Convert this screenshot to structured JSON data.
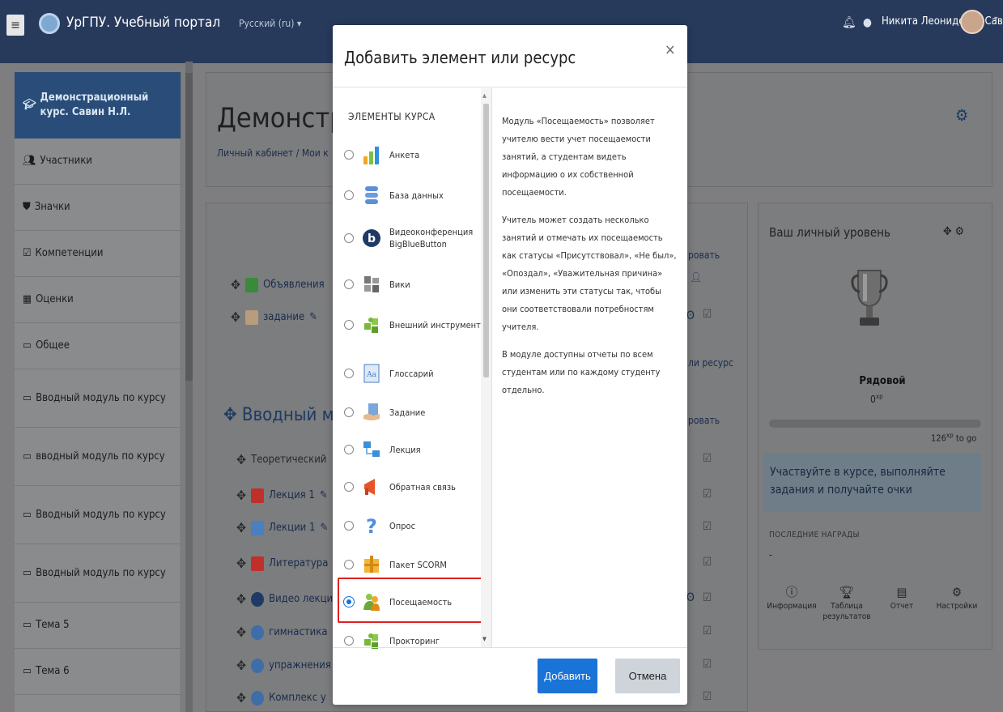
{
  "topbar": {
    "menu_icon": "hamburger-icon",
    "site_name": "УрГПУ. Учебный портал",
    "language": "Русский (ru) ▾",
    "user_name": "Никита Леонидович Савин"
  },
  "sidebar": {
    "items": [
      {
        "label": "Демонстрационный курс. Савин Н.Л.",
        "icon": "graduation-cap-icon"
      },
      {
        "label": "Участники",
        "icon": "users-icon"
      },
      {
        "label": "Значки",
        "icon": "shield-icon"
      },
      {
        "label": "Компетенции",
        "icon": "checkbox-icon"
      },
      {
        "label": "Оценки",
        "icon": "table-icon"
      },
      {
        "label": "Общее",
        "icon": "folder-icon"
      },
      {
        "label": "Вводный модуль по курсу",
        "icon": "folder-icon"
      },
      {
        "label": "вводный модуль по курсу",
        "icon": "folder-icon"
      },
      {
        "label": "Вводный модуль по курсу",
        "icon": "folder-icon"
      },
      {
        "label": "Вводный модуль по курсу",
        "icon": "folder-icon"
      },
      {
        "label": "Тема 5",
        "icon": "folder-icon"
      },
      {
        "label": "Тема 6",
        "icon": "folder-icon"
      }
    ]
  },
  "course": {
    "title": "Демонстра",
    "breadcrumb": "Личный кабинет / Мои к",
    "rows_top": [
      "Объявления",
      "задание"
    ],
    "section_title": "Вводный мод",
    "rows": [
      "Теоретический",
      "Лекция 1",
      "Лекции 1",
      "Литература",
      "Видео лекци",
      "гимнастика",
      "упражнения",
      "Комплекс у"
    ],
    "edit_link": "ровать",
    "add_link": "или ресурс"
  },
  "level": {
    "title": "Ваш личный уровень",
    "rank": "Рядовой",
    "xp": "0",
    "xp_unit": "xp",
    "to_go": "126",
    "to_go_text": "to go",
    "progress": 0,
    "info": "Участвуйте в курсе, выполняйте задания и получайте очки",
    "awards_label": "ПОСЛЕДНИЕ НАГРАДЫ",
    "awards_empty": "-",
    "buttons": [
      "Информация",
      "Таблица результатов",
      "Отчет",
      "Настройки"
    ]
  },
  "modal": {
    "title": "Добавить элемент или ресурс",
    "close": "×",
    "section_header": "ЭЛЕМЕНТЫ КУРСА",
    "modules": [
      {
        "label": "Анкета",
        "icon": "chart-icon",
        "color": "#f5a623"
      },
      {
        "label": "База данных",
        "icon": "database-icon",
        "color": "#5b8fd9"
      },
      {
        "label": "Видеоконференция BigBlueButton",
        "icon": "bigbluebutton-icon",
        "color": "#1f3a66"
      },
      {
        "label": "Вики",
        "icon": "wiki-icon",
        "color": "#666666"
      },
      {
        "label": "Внешний инструмент",
        "icon": "puzzle-icon",
        "color": "#79b83c"
      },
      {
        "label": "Глоссарий",
        "icon": "glossary-icon",
        "color": "#4a7fc0"
      },
      {
        "label": "Задание",
        "icon": "assignment-icon",
        "color": "#e8b98c"
      },
      {
        "label": "Лекция",
        "icon": "lesson-icon",
        "color": "#3a8fd8"
      },
      {
        "label": "Обратная связь",
        "icon": "megaphone-icon",
        "color": "#e8532a"
      },
      {
        "label": "Опрос",
        "icon": "question-icon",
        "color": "#4f8fe0"
      },
      {
        "label": "Пакет SCORM",
        "icon": "scorm-icon",
        "color": "#e8a020"
      },
      {
        "label": "Посещаемость",
        "icon": "attendance-icon",
        "color": "#6aa83a"
      },
      {
        "label": "Прокторинг",
        "icon": "puzzle-icon",
        "color": "#79b83c"
      }
    ],
    "selected_index": 11,
    "description": [
      "Модуль «Посещаемость» позволяет учителю вести учет посещаемости занятий, а студентам видеть информацию о их собственной посещаемости.",
      "Учитель может создать несколько занятий и отмечать их посещаемость как статусы «Присутствовал», «Не был», «Опоздал», «Уважительная причина» или изменить эти статусы так, чтобы они соответствовали потребностям учителя.",
      "В модуле доступны отчеты по всем студентам или по каждому студенту отдельно."
    ],
    "add_button": "Добавить",
    "cancel_button": "Отмена"
  }
}
